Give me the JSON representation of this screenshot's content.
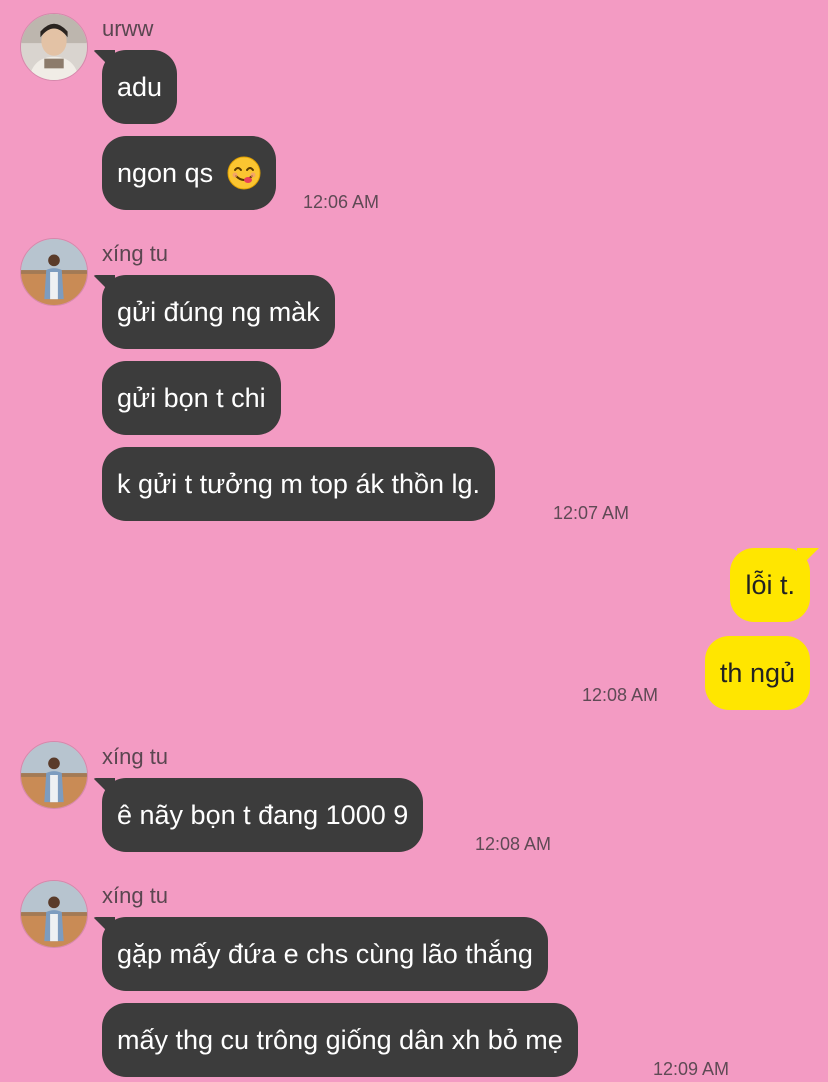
{
  "colors": {
    "background": "#f39bc3",
    "incoming_bubble": "#3c3c3c",
    "outgoing_bubble": "#ffe600"
  },
  "groups": [
    {
      "sender": "urww",
      "avatar": "avatar-urww",
      "messages": [
        "adu",
        "ngon qs"
      ],
      "time": "12:06 AM"
    },
    {
      "sender": "xíng tu",
      "avatar": "avatar-xing-tu",
      "messages": [
        "gửi đúng ng màk",
        "gửi bọn t chi",
        "k gửi t tưởng m top ák thồn lg."
      ],
      "time": "12:07 AM"
    },
    {
      "sender": "me",
      "messages": [
        "lỗi t.",
        "th ngủ"
      ],
      "time": "12:08 AM"
    },
    {
      "sender": "xíng tu",
      "avatar": "avatar-xing-tu",
      "messages": [
        "ê nãy bọn t đang 1000 9"
      ],
      "time": "12:08 AM"
    },
    {
      "sender": "xíng tu",
      "avatar": "avatar-xing-tu",
      "messages": [
        "gặp mấy đứa e chs cùng lão thắng",
        "mấy thg cu trông giống dân xh bỏ mẹ"
      ],
      "time": "12:09 AM"
    }
  ],
  "emoji": "yum-face-emoji"
}
